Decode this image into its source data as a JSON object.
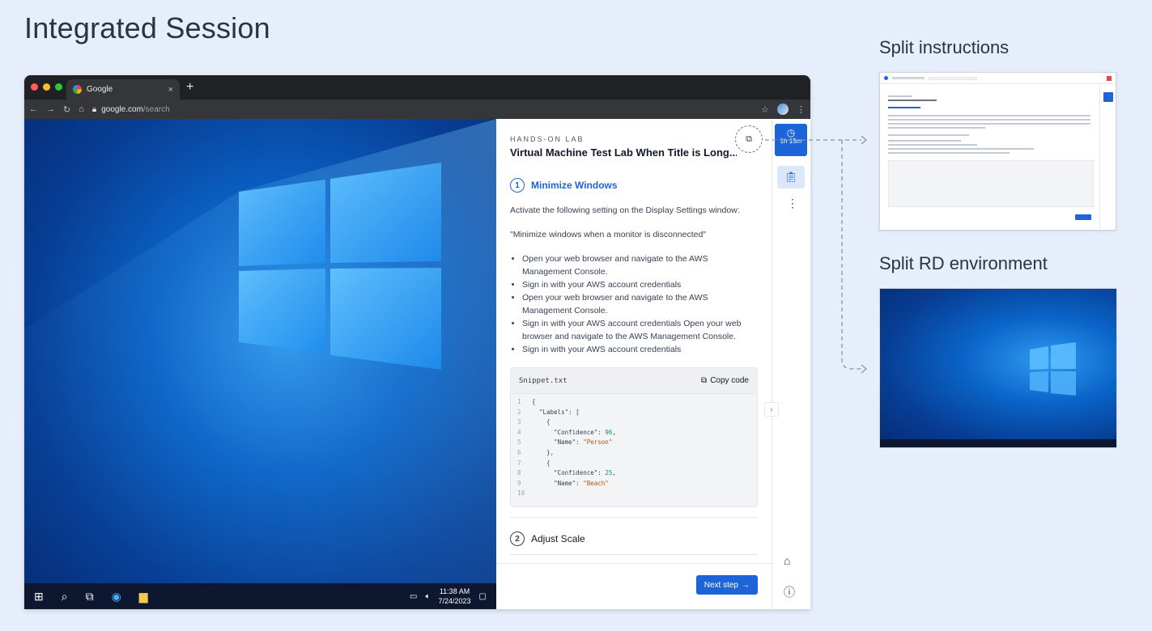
{
  "page": {
    "title": "Integrated Session",
    "split_instructions_label": "Split instructions",
    "split_rd_label": "Split RD environment"
  },
  "browser": {
    "tab_title": "Google",
    "tab_close": "×",
    "new_tab": "+",
    "url_host": "google.com",
    "url_path": "/search"
  },
  "lab": {
    "kicker": "HANDS-ON LAB",
    "title": "Virtual Machine Test Lab When Title is Long...",
    "step1": {
      "number": "1",
      "title": "Minimize Windows",
      "intro": "Activate the following setting on the Display Settings window:",
      "quote": "\"Minimize windows when a monitor is disconnected\"",
      "bullets": [
        "Open your web browser and navigate to the AWS Management Console.",
        "Sign in with your AWS account credentials",
        "Open your web browser and navigate to the AWS Management Console.",
        "Sign in with your AWS account credentials Open your web browser and navigate to the AWS Management Console.",
        "Sign in with your AWS account credentials"
      ]
    },
    "snippet": {
      "filename": "Snippet.txt",
      "copy_label": "Copy code",
      "lines": [
        {
          "n": "1",
          "text": "{"
        },
        {
          "n": "2",
          "text": "  \"Labels\": ["
        },
        {
          "n": "3",
          "text": "    {"
        },
        {
          "n": "4",
          "key": "      \"Confidence\": ",
          "num": "96",
          "tail": ","
        },
        {
          "n": "5",
          "key": "      \"Name\": ",
          "str": "\"Person\""
        },
        {
          "n": "6",
          "text": "    },"
        },
        {
          "n": "7",
          "text": "    {"
        },
        {
          "n": "8",
          "key": "      \"Confidence\": ",
          "num": "25",
          "tail": ","
        },
        {
          "n": "9",
          "key": "      \"Name\": ",
          "str": "\"Beach\""
        },
        {
          "n": "10",
          "text": ""
        }
      ]
    },
    "step2": {
      "number": "2",
      "title": "Adjust Scale"
    },
    "next_button": "Next step",
    "timer": "1h 15m"
  },
  "taskbar": {
    "time": "11:38 AM",
    "date": "7/24/2023"
  },
  "colors": {
    "accent": "#1d64d8",
    "background": "#e6eefb"
  },
  "icons": {
    "split": "split-view-icon",
    "timer": "clock-icon",
    "clipboard": "clipboard-icon",
    "home": "home-icon",
    "info": "info-icon"
  }
}
